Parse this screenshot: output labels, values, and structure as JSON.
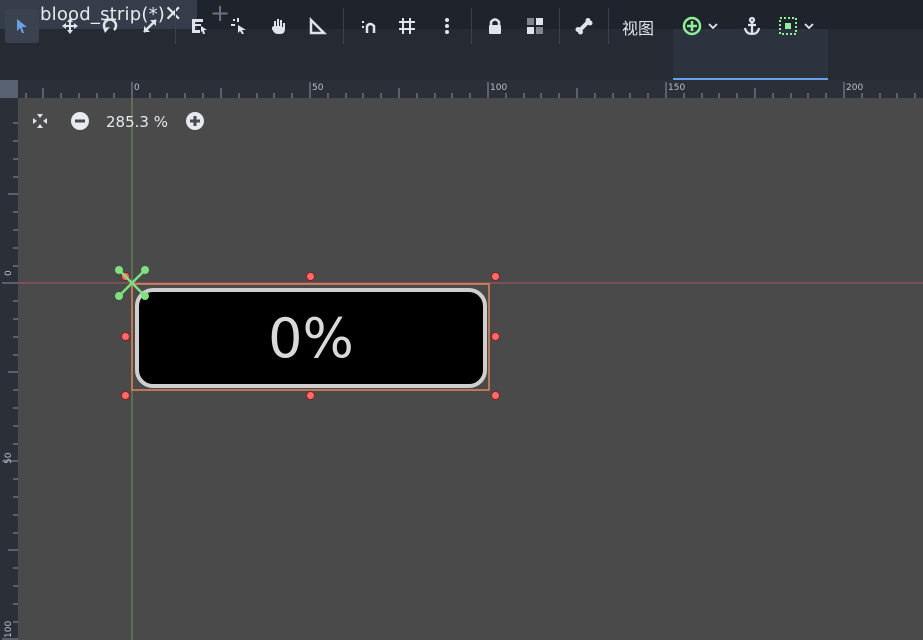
{
  "tab": {
    "title": "blood_strip(*)",
    "close": "✕",
    "add": "+"
  },
  "toolbar": {
    "view_label": "视图"
  },
  "ruler": {
    "top_labels": [
      "0",
      "50",
      "100",
      "150",
      "200"
    ],
    "left_labels": [
      "0",
      "50",
      "100"
    ]
  },
  "zoom": {
    "level": "285.3 %"
  },
  "canvas": {
    "progress_text": "0%",
    "progress_value": 0
  },
  "colors": {
    "accent": "#6aa0e6",
    "selection": "#e0885a",
    "handle": "#ff6b6b",
    "pivot": "#7ee07e"
  }
}
